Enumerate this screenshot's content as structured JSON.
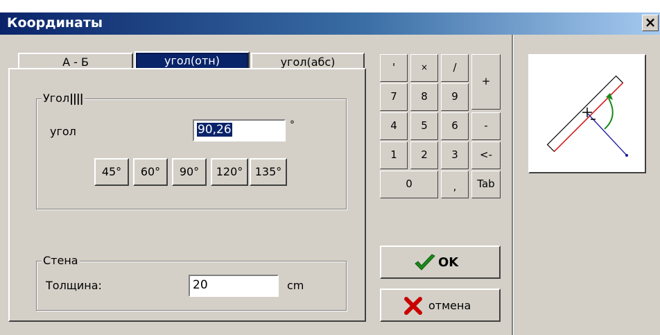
{
  "window": {
    "title": "Координаты",
    "close_label": "×"
  },
  "tabs": [
    {
      "label": "А - Б",
      "active": false
    },
    {
      "label": "угол(отн)",
      "active": true
    },
    {
      "label": "угол(абс)",
      "active": false
    }
  ],
  "angle_group": {
    "title": "Угол",
    "angle_label": "угол",
    "angle_value": "90,26",
    "unit": "°",
    "preset_buttons": [
      "45°",
      "60°",
      "90°",
      "120°",
      "135°"
    ]
  },
  "wall_group": {
    "title": "Стена",
    "thickness_label": "Толщина:",
    "thickness_value": "20",
    "unit": "cm"
  },
  "keypad": {
    "row1": [
      "'",
      "×",
      "/"
    ],
    "plus": "+",
    "row2": [
      "7",
      "8",
      "9"
    ],
    "row3": [
      "4",
      "5",
      "6"
    ],
    "minus": "-",
    "row4": [
      "1",
      "2",
      "3"
    ],
    "back": "<-",
    "zero": "0",
    "comma": ",",
    "tab": "Tab"
  },
  "actions": {
    "ok_label": "OK",
    "cancel_label": "отмена"
  },
  "colors": {
    "ok_check": "#1a8a1a",
    "cancel_x": "#c80000",
    "active_tab": "#0a246a",
    "accent_red": "#d81a1a"
  }
}
